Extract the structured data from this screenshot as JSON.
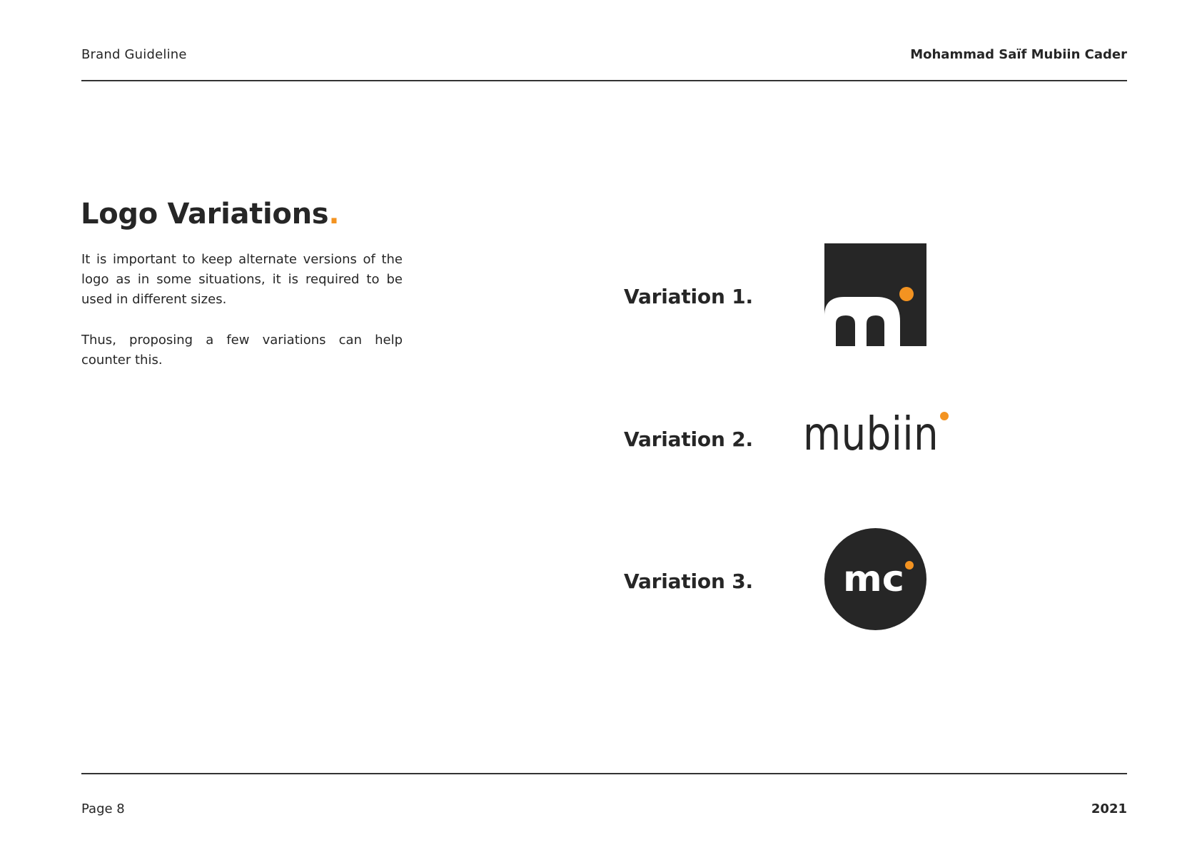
{
  "header": {
    "left": "Brand Guideline",
    "right": "Mohammad Saïf Mubiin Cader"
  },
  "main": {
    "title": "Logo Variations",
    "title_accent": ".",
    "paragraphs": [
      "It is important to keep alternate versions of the logo as in some situations, it is required to be used in different sizes.",
      "Thus, proposing a few variations can help counter this."
    ]
  },
  "variations": [
    {
      "label": "Variation 1.",
      "logo": "m-square-mark-icon"
    },
    {
      "label": "Variation 2.",
      "logo": "mubiin-wordmark",
      "wordmark_text": "mubiin"
    },
    {
      "label": "Variation 3.",
      "logo": "mc-circle-mark-icon",
      "mark_text": "mc"
    }
  ],
  "colors": {
    "dark": "#262626",
    "accent": "#f39321",
    "background": "#ffffff"
  },
  "footer": {
    "page": "Page 8",
    "year": "2021"
  }
}
